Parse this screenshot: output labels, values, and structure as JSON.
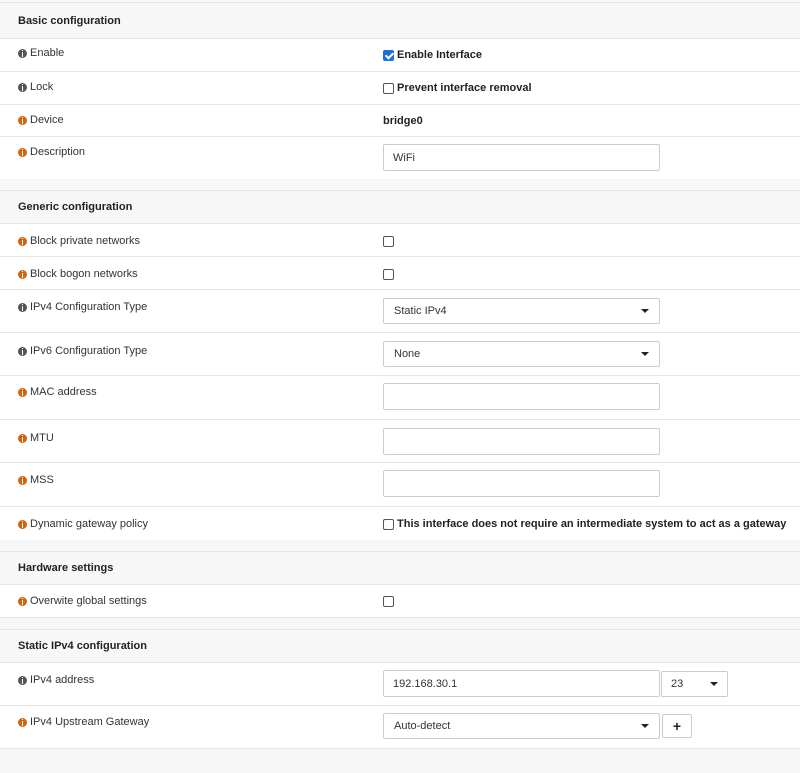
{
  "basic": {
    "title": "Basic configuration",
    "enable": {
      "label": "Enable",
      "checkbox_label": "Enable Interface",
      "checked": true
    },
    "lock": {
      "label": "Lock",
      "checkbox_label": "Prevent interface removal",
      "checked": false
    },
    "device": {
      "label": "Device",
      "value": "bridge0"
    },
    "description": {
      "label": "Description",
      "value": "WiFi"
    }
  },
  "generic": {
    "title": "Generic configuration",
    "block_private": {
      "label": "Block private networks",
      "checked": false
    },
    "block_bogon": {
      "label": "Block bogon networks",
      "checked": false
    },
    "ipv4_type": {
      "label": "IPv4 Configuration Type",
      "value": "Static IPv4"
    },
    "ipv6_type": {
      "label": "IPv6 Configuration Type",
      "value": "None"
    },
    "mac": {
      "label": "MAC address",
      "value": ""
    },
    "mtu": {
      "label": "MTU",
      "value": ""
    },
    "mss": {
      "label": "MSS",
      "value": ""
    },
    "dynamic_gw": {
      "label": "Dynamic gateway policy",
      "checkbox_label": "This interface does not require an intermediate system to act as a gateway",
      "checked": false
    }
  },
  "hardware": {
    "title": "Hardware settings",
    "overwrite": {
      "label": "Overwite global settings",
      "checked": false
    }
  },
  "static_ipv4": {
    "title": "Static IPv4 configuration",
    "address": {
      "label": "IPv4 address",
      "value": "192.168.30.1",
      "prefix": "23"
    },
    "gateway": {
      "label": "IPv4 Upstream Gateway",
      "value": "Auto-detect",
      "add_label": "+"
    }
  },
  "icons": {
    "info_gray": "info-circle-icon",
    "info_orange": "info-circle-icon",
    "accent": "#1e6fd9",
    "info_orange_color": "#d2640f",
    "info_gray_color": "#555555"
  }
}
